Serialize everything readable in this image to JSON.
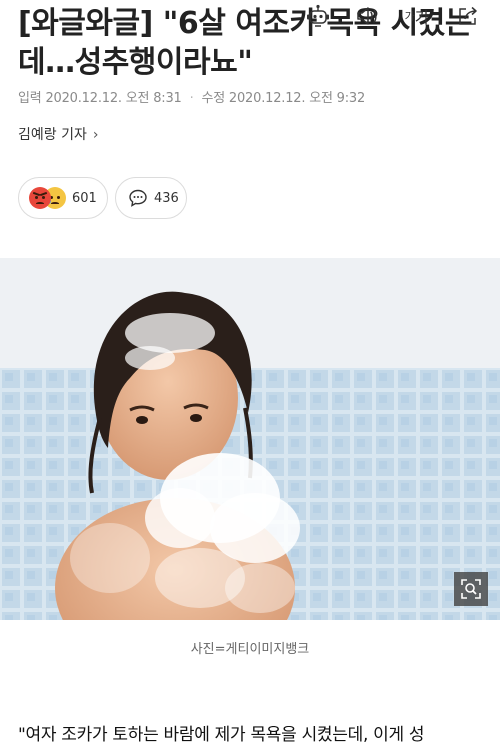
{
  "article": {
    "headline": "[와글와글] \"6살 여조카 목욕 시켰는데…성추행이라뇨\"",
    "published_label": "입력",
    "published_time": "2020.12.12. 오전 8:31",
    "modified_label": "수정",
    "modified_time": "2020.12.12. 오전 9:32",
    "reporter": "김예랑 기자",
    "reporter_chevron": "›",
    "photo_caption": "사진=게티이미지뱅크",
    "body_first_line": "\"여자 조카가 토하는 바람에 제가 목욕을 시켰는데, 이게 성"
  },
  "toolbar": {
    "reaction_count": "601",
    "comment_count": "436",
    "font_size_label_small": "가",
    "font_size_label_large": "가"
  },
  "icons": [
    "angry-emoji-icon",
    "sad-emoji-icon",
    "comment-bubble-icon",
    "robot-summary-icon",
    "speaker-icon",
    "font-size-icon",
    "share-icon",
    "zoom-icon"
  ],
  "colors": {
    "angry_emoji": "#e8473b",
    "sad_emoji": "#f4c542",
    "meta_text": "#8a8a8a",
    "pill_border": "#dcdcdc"
  }
}
